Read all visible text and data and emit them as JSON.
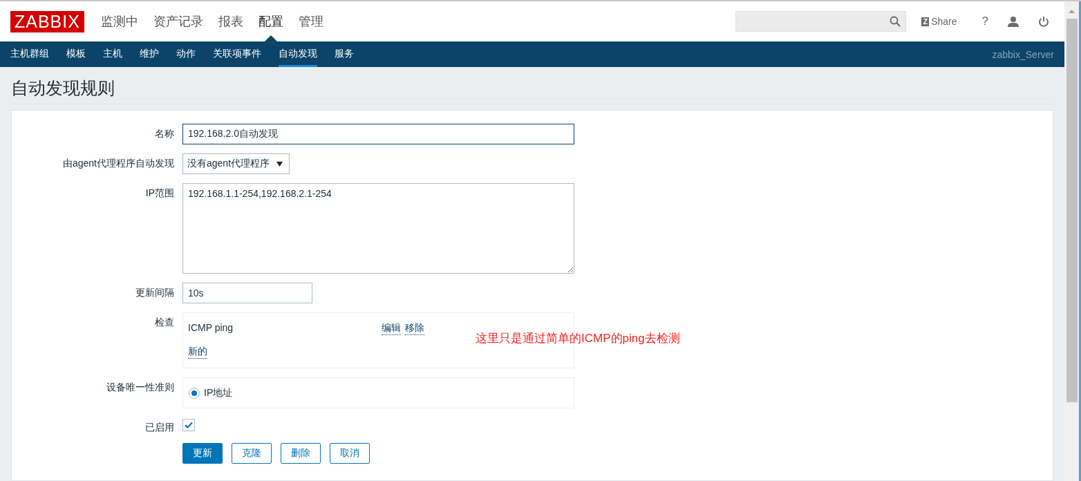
{
  "header": {
    "logo": "ZABBIX",
    "menu": [
      {
        "label": "监测中",
        "selected": false
      },
      {
        "label": "资产记录",
        "selected": false
      },
      {
        "label": "报表",
        "selected": false
      },
      {
        "label": "配置",
        "selected": true
      },
      {
        "label": "管理",
        "selected": false
      }
    ],
    "share_badge": "Z",
    "share": "Share",
    "help": "?"
  },
  "subnav": {
    "items": [
      {
        "label": "主机群组",
        "selected": false
      },
      {
        "label": "模板",
        "selected": false
      },
      {
        "label": "主机",
        "selected": false
      },
      {
        "label": "维护",
        "selected": false
      },
      {
        "label": "动作",
        "selected": false
      },
      {
        "label": "关联项事件",
        "selected": false
      },
      {
        "label": "自动发现",
        "selected": true
      },
      {
        "label": "服务",
        "selected": false
      }
    ],
    "server": "zabbix_Server"
  },
  "page_title": "自动发现规则",
  "form": {
    "name": {
      "label": "名称",
      "value": "192.168.2.0自动发现"
    },
    "proxy": {
      "label": "由agent代理程序自动发现",
      "value": "没有agent代理程序"
    },
    "ip_range": {
      "label": "IP范围",
      "value": "192.168.1.1-254,192.168.2.1-254"
    },
    "interval": {
      "label": "更新间隔",
      "value": "10s"
    },
    "checks": {
      "label": "检查",
      "items": [
        {
          "name": "ICMP ping",
          "actions": [
            "编辑",
            "移除"
          ]
        }
      ],
      "new_link": "新的"
    },
    "uniqueness": {
      "label": "设备唯一性准则",
      "options": [
        {
          "label": "IP地址",
          "selected": true
        }
      ]
    },
    "enabled": {
      "label": "已启用",
      "checked": true
    },
    "buttons": [
      {
        "label": "更新",
        "kind": "primary"
      },
      {
        "label": "克隆",
        "kind": "secondary"
      },
      {
        "label": "删除",
        "kind": "secondary"
      },
      {
        "label": "取消",
        "kind": "secondary"
      }
    ]
  },
  "annotation": "这里只是通过简单的ICMP的ping去检测"
}
